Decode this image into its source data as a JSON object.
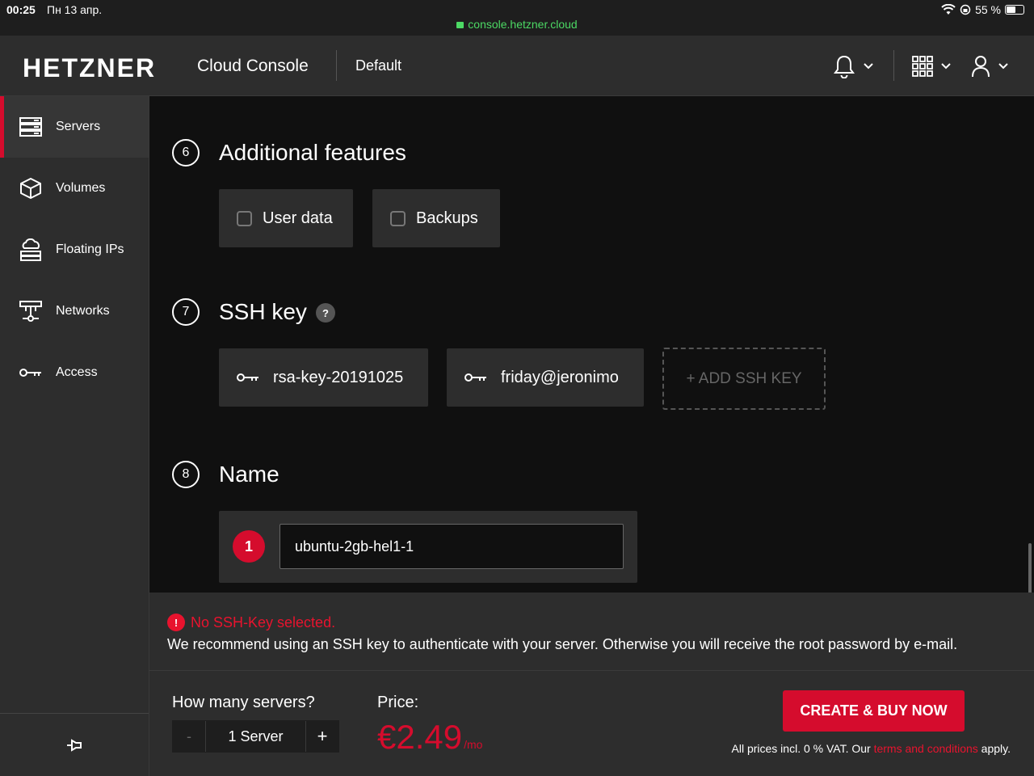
{
  "status_bar": {
    "time": "00:25",
    "date": "Пн 13 апр.",
    "url": "console.hetzner.cloud",
    "battery": "55 %"
  },
  "header": {
    "logo": "HETZNER",
    "product": "Cloud Console",
    "project": "Default"
  },
  "sidebar": {
    "items": [
      {
        "label": "Servers",
        "icon": "server-icon",
        "active": true
      },
      {
        "label": "Volumes",
        "icon": "cube-icon"
      },
      {
        "label": "Floating IPs",
        "icon": "floating-ip-icon"
      },
      {
        "label": "Networks",
        "icon": "network-icon"
      },
      {
        "label": "Access",
        "icon": "key-icon"
      }
    ]
  },
  "sections": {
    "additional": {
      "number": "6",
      "title": "Additional features",
      "options": [
        {
          "label": "User data",
          "checked": false
        },
        {
          "label": "Backups",
          "checked": false
        }
      ]
    },
    "ssh": {
      "number": "7",
      "title": "SSH key",
      "help": "?",
      "keys": [
        {
          "label": "rsa-key-20191025"
        },
        {
          "label": "friday@jeronimo"
        }
      ],
      "add_label": "+  ADD SSH KEY"
    },
    "name": {
      "number": "8",
      "title": "Name",
      "count": "1",
      "value": "ubuntu-2gb-hel1-1"
    }
  },
  "warning": {
    "icon": "!",
    "title": "No SSH-Key selected.",
    "text": "We recommend using an SSH key to authenticate with your server. Otherwise you will receive the root password by e-mail."
  },
  "footer": {
    "count_label": "How many servers?",
    "minus": "-",
    "count_value": "1 Server",
    "plus": "+",
    "price_label": "Price:",
    "price": "€2.49",
    "price_unit": "/mo",
    "buy_label": "CREATE & BUY NOW",
    "vat_prefix": "All prices incl. 0 % VAT. Our ",
    "vat_link": "terms and conditions",
    "vat_suffix": " apply."
  },
  "colors": {
    "accent": "#d50c2d",
    "background": "#101010",
    "panel": "#2d2d2d"
  }
}
